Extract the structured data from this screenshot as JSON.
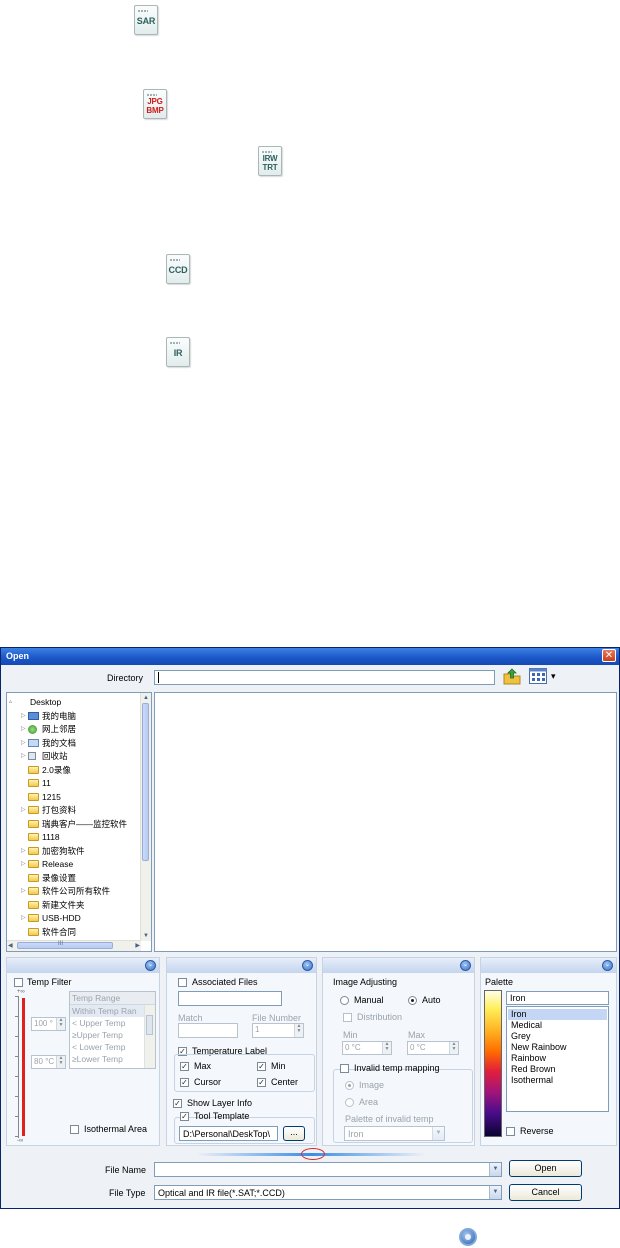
{
  "file_icons": [
    {
      "name": "sar-file-icon",
      "lines": [
        "SAR"
      ],
      "accent": "#2f5f5f"
    },
    {
      "name": "jpg-bmp-file-icon",
      "lines": [
        "JPG",
        "BMP"
      ],
      "accent": "#d11a1a"
    },
    {
      "name": "irw-trt-file-icon",
      "lines": [
        "IRW",
        "TRT"
      ],
      "accent": "#2f5f5f"
    },
    {
      "name": "ccd-file-icon",
      "lines": [
        "CCD"
      ],
      "accent": "#2f5f5f"
    },
    {
      "name": "ir-file-icon",
      "lines": [
        "IR"
      ],
      "accent": "#2f5f5f"
    }
  ],
  "dialog": {
    "title": "Open",
    "close_glyph": "✕",
    "directory_label": "Directory",
    "directory_value": "",
    "view_dropdown_glyph": "▾"
  },
  "tree": {
    "items": [
      {
        "label": "Desktop",
        "icon": "desktop",
        "expander": "▵"
      },
      {
        "label": "我的电脑",
        "icon": "pc",
        "expander": "▷"
      },
      {
        "label": "网上邻居",
        "icon": "net",
        "expander": "▷"
      },
      {
        "label": "我的文档",
        "icon": "docs",
        "expander": "▷"
      },
      {
        "label": "回收站",
        "icon": "bin",
        "expander": "▷"
      },
      {
        "label": "2.0录像",
        "icon": "folder",
        "expander": ""
      },
      {
        "label": "11",
        "icon": "folder",
        "expander": ""
      },
      {
        "label": "1215",
        "icon": "folder",
        "expander": ""
      },
      {
        "label": "打包资料",
        "icon": "folder",
        "expander": "▷"
      },
      {
        "label": "瑞典客户——监控软件",
        "icon": "folder",
        "expander": ""
      },
      {
        "label": "1118",
        "icon": "folder",
        "expander": ""
      },
      {
        "label": "加密狗软件",
        "icon": "folder",
        "expander": "▷"
      },
      {
        "label": "Release",
        "icon": "folder",
        "expander": "▷"
      },
      {
        "label": "录像设置",
        "icon": "folder",
        "expander": ""
      },
      {
        "label": "软件公司所有软件",
        "icon": "folder",
        "expander": "▷"
      },
      {
        "label": "新建文件夹",
        "icon": "folder",
        "expander": ""
      },
      {
        "label": "USB-HDD",
        "icon": "folder",
        "expander": "▷"
      },
      {
        "label": "软件合同",
        "icon": "folder",
        "expander": ""
      }
    ],
    "hscroll_grip": "III"
  },
  "temp_filter": {
    "checkbox_label": "Temp Filter",
    "checked": false,
    "range_header": "Temp Range",
    "range_items": [
      "Within Temp Ran",
      "< Upper Temp",
      "≥Upper Temp",
      "< Lower Temp",
      "≥Lower Temp"
    ],
    "upper_value": "100 °",
    "lower_value": "80 °C",
    "isothermal_label": "Isothermal Area",
    "isothermal_checked": false,
    "scale_top": "+∞",
    "scale_bottom": "-∞"
  },
  "associated": {
    "checkbox_label": "Associated Files",
    "checked": false,
    "match_label": "Match",
    "file_number_label": "File Number",
    "file_number_value": "1",
    "temperature_label": "Temperature Label",
    "temperature_checked": true,
    "max_label": "Max",
    "max_checked": true,
    "min_label": "Min",
    "min_checked": true,
    "cursor_label": "Cursor",
    "cursor_checked": true,
    "center_label": "Center",
    "center_checked": true,
    "show_layer_label": "Show Layer Info",
    "show_layer_checked": true,
    "tool_template_label": "Tool Template",
    "tool_template_checked": true,
    "template_path": "D:\\Personal\\DeskTop\\",
    "browse_label": "..."
  },
  "image_adjusting": {
    "title": "Image Adjusting",
    "manual_label": "Manual",
    "auto_label": "Auto",
    "selected": "Auto",
    "distribution_label": "Distribution",
    "min_label": "Min",
    "max_label": "Max",
    "min_value": "0 °C",
    "max_value": "0 °C",
    "invalid_label": "Invalid temp mapping",
    "invalid_checked": false,
    "image_label": "Image",
    "area_label": "Area",
    "palette_invalid_label": "Palette of invalid temp",
    "palette_invalid_value": "Iron"
  },
  "palette": {
    "title": "Palette",
    "current": "Iron",
    "options": [
      "Iron",
      "Medical",
      "Grey",
      "New Rainbow",
      "Rainbow",
      "Red Brown",
      "Isothermal"
    ],
    "selected_index": 0,
    "reverse_label": "Reverse",
    "reverse_checked": false
  },
  "footer": {
    "file_name_label": "File Name",
    "file_name_value": "",
    "file_type_label": "File Type",
    "file_type_value": "Optical and IR file(*.SAT;*.CCD)",
    "open_label": "Open",
    "cancel_label": "Cancel"
  },
  "colors": {
    "title_bar": "#1d58c8",
    "selection": "#c3d7f4",
    "panel_header": "#c4d5ee",
    "scale_red": "#e02020"
  },
  "glyphs": {
    "check": "✓",
    "dropdown": "▼",
    "collapse": "⌄",
    "spin_up": "▲",
    "spin_down": "▼"
  }
}
